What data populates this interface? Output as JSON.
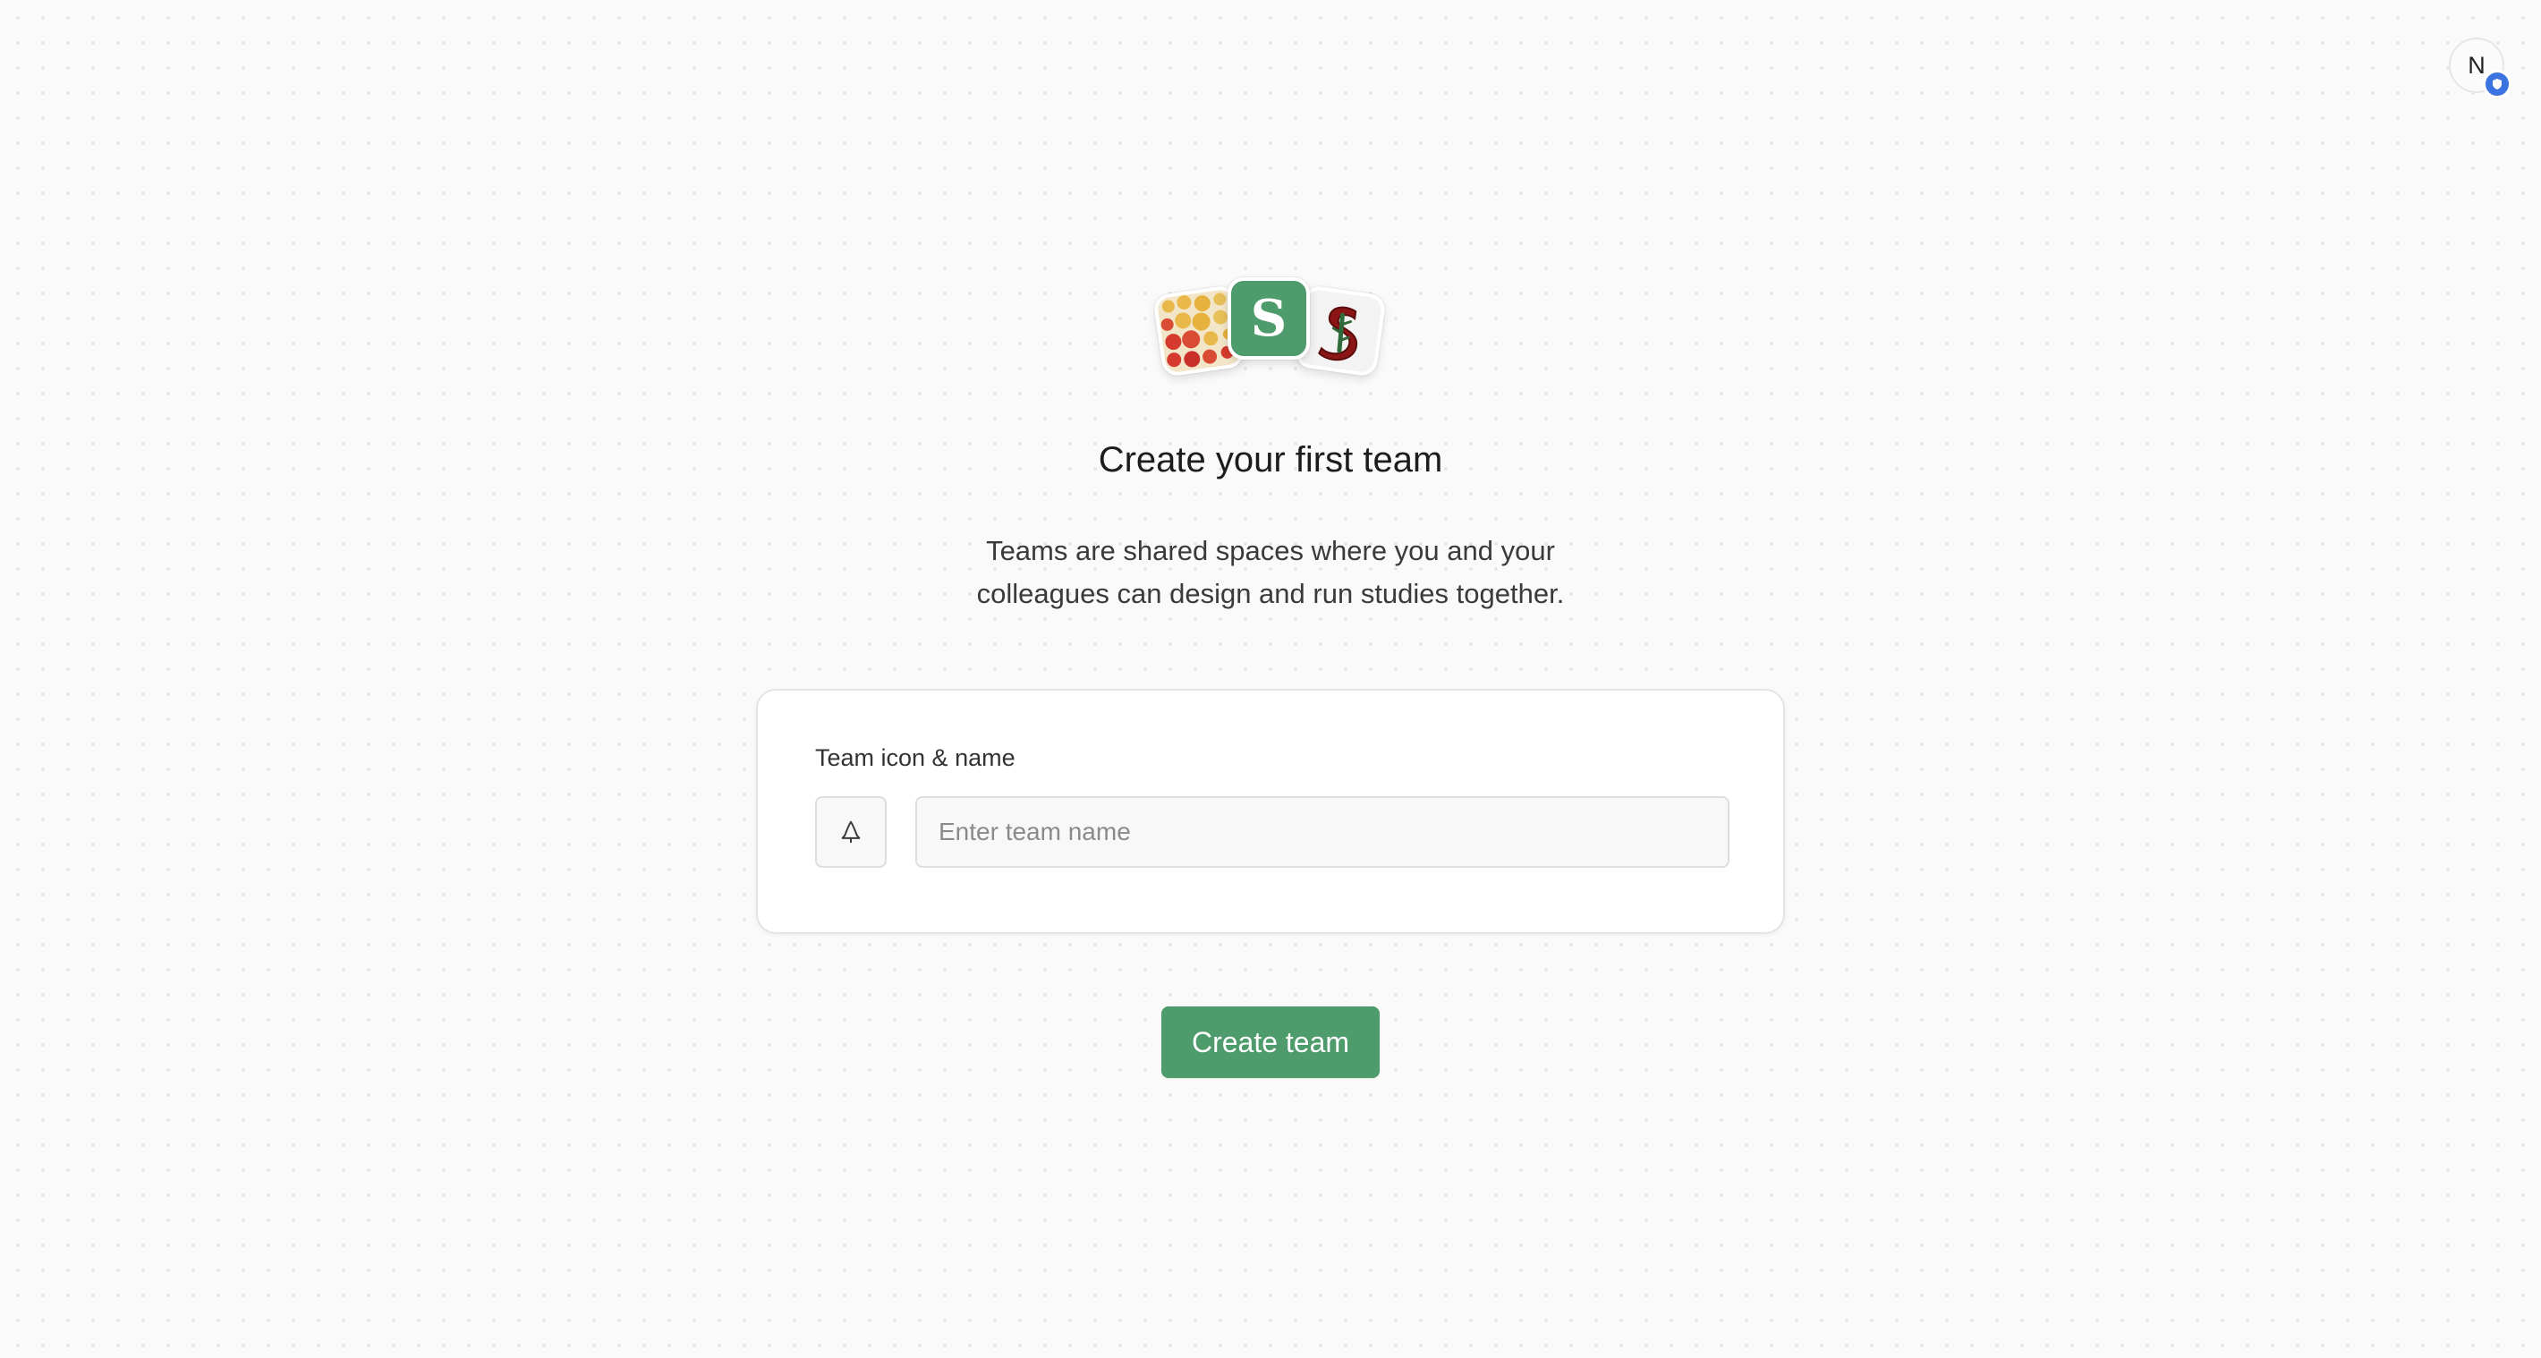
{
  "header": {
    "avatar_initial": "N"
  },
  "hero": {
    "center_logo_letter": "S",
    "title": "Create your first team",
    "subtitle_line1": "Teams are shared spaces where you and your",
    "subtitle_line2": "colleagues can design and run studies together."
  },
  "form": {
    "field_label": "Team icon & name",
    "icon_button_icon": "tree-icon",
    "name_input_value": "",
    "name_input_placeholder": "Enter team name"
  },
  "actions": {
    "create_label": "Create team"
  },
  "colors": {
    "accent_green": "#4e9b6c",
    "badge_blue": "#3b74e0",
    "background": "#fafafa"
  }
}
